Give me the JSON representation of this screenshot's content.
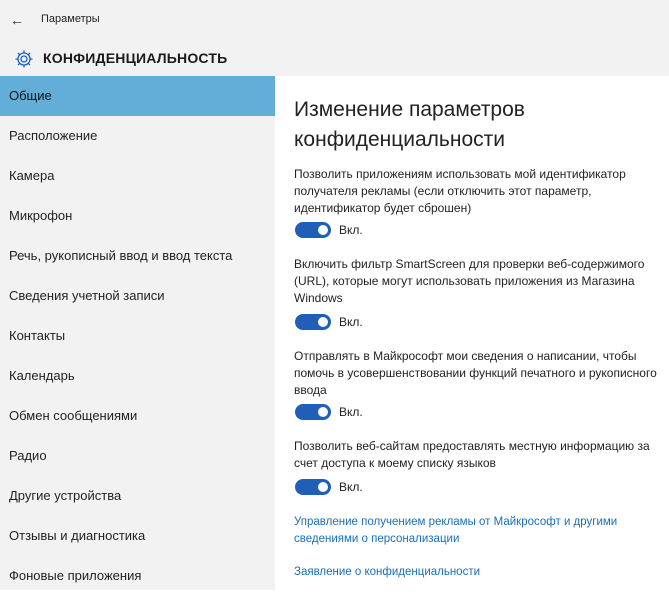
{
  "window": {
    "back_icon": "back-arrow-icon",
    "app_title": "Параметры"
  },
  "header": {
    "icon": "gear-icon",
    "title": "КОНФИДЕНЦИАЛЬНОСТЬ"
  },
  "sidebar": {
    "items": [
      {
        "label": "Общие",
        "active": true
      },
      {
        "label": "Расположение",
        "active": false
      },
      {
        "label": "Камера",
        "active": false
      },
      {
        "label": "Микрофон",
        "active": false
      },
      {
        "label": "Речь, рукописный ввод и ввод текста",
        "active": false
      },
      {
        "label": "Сведения учетной записи",
        "active": false
      },
      {
        "label": "Контакты",
        "active": false
      },
      {
        "label": "Календарь",
        "active": false
      },
      {
        "label": "Обмен сообщениями",
        "active": false
      },
      {
        "label": "Радио",
        "active": false
      },
      {
        "label": "Другие устройства",
        "active": false
      },
      {
        "label": "Отзывы и диагностика",
        "active": false
      },
      {
        "label": "Фоновые приложения",
        "active": false
      }
    ]
  },
  "main": {
    "title_line1": "Изменение параметров",
    "title_line2": "конфиденциальности",
    "settings": [
      {
        "description": "Позволить приложениям использовать мой идентификатор получателя рекламы (если отключить этот параметр, идентификатор будет сброшен)",
        "state": "Вкл.",
        "on": true
      },
      {
        "description": "Включить фильтр SmartScreen для проверки веб-содержимого (URL), которые могут использовать приложения из Магазина Windows",
        "state": "Вкл.",
        "on": true
      },
      {
        "description": "Отправлять в Майкрософт мои сведения о написании, чтобы помочь в усовершенствовании функций печатного и рукописного ввода",
        "state": "Вкл.",
        "on": true
      },
      {
        "description": "Позволить веб-сайтам предоставлять местную информацию за счет доступа к моему списку языков",
        "state": "Вкл.",
        "on": true
      }
    ],
    "links": {
      "ads": "Управление получением рекламы от Майкрософт и другими сведениями о персонализации",
      "privacy": "Заявление о конфиденциальности"
    }
  },
  "colors": {
    "accent": "#1f5fb8",
    "selected_nav": "#63aed9",
    "link": "#1a6fb5",
    "chrome_bg": "#f2f2f2"
  }
}
